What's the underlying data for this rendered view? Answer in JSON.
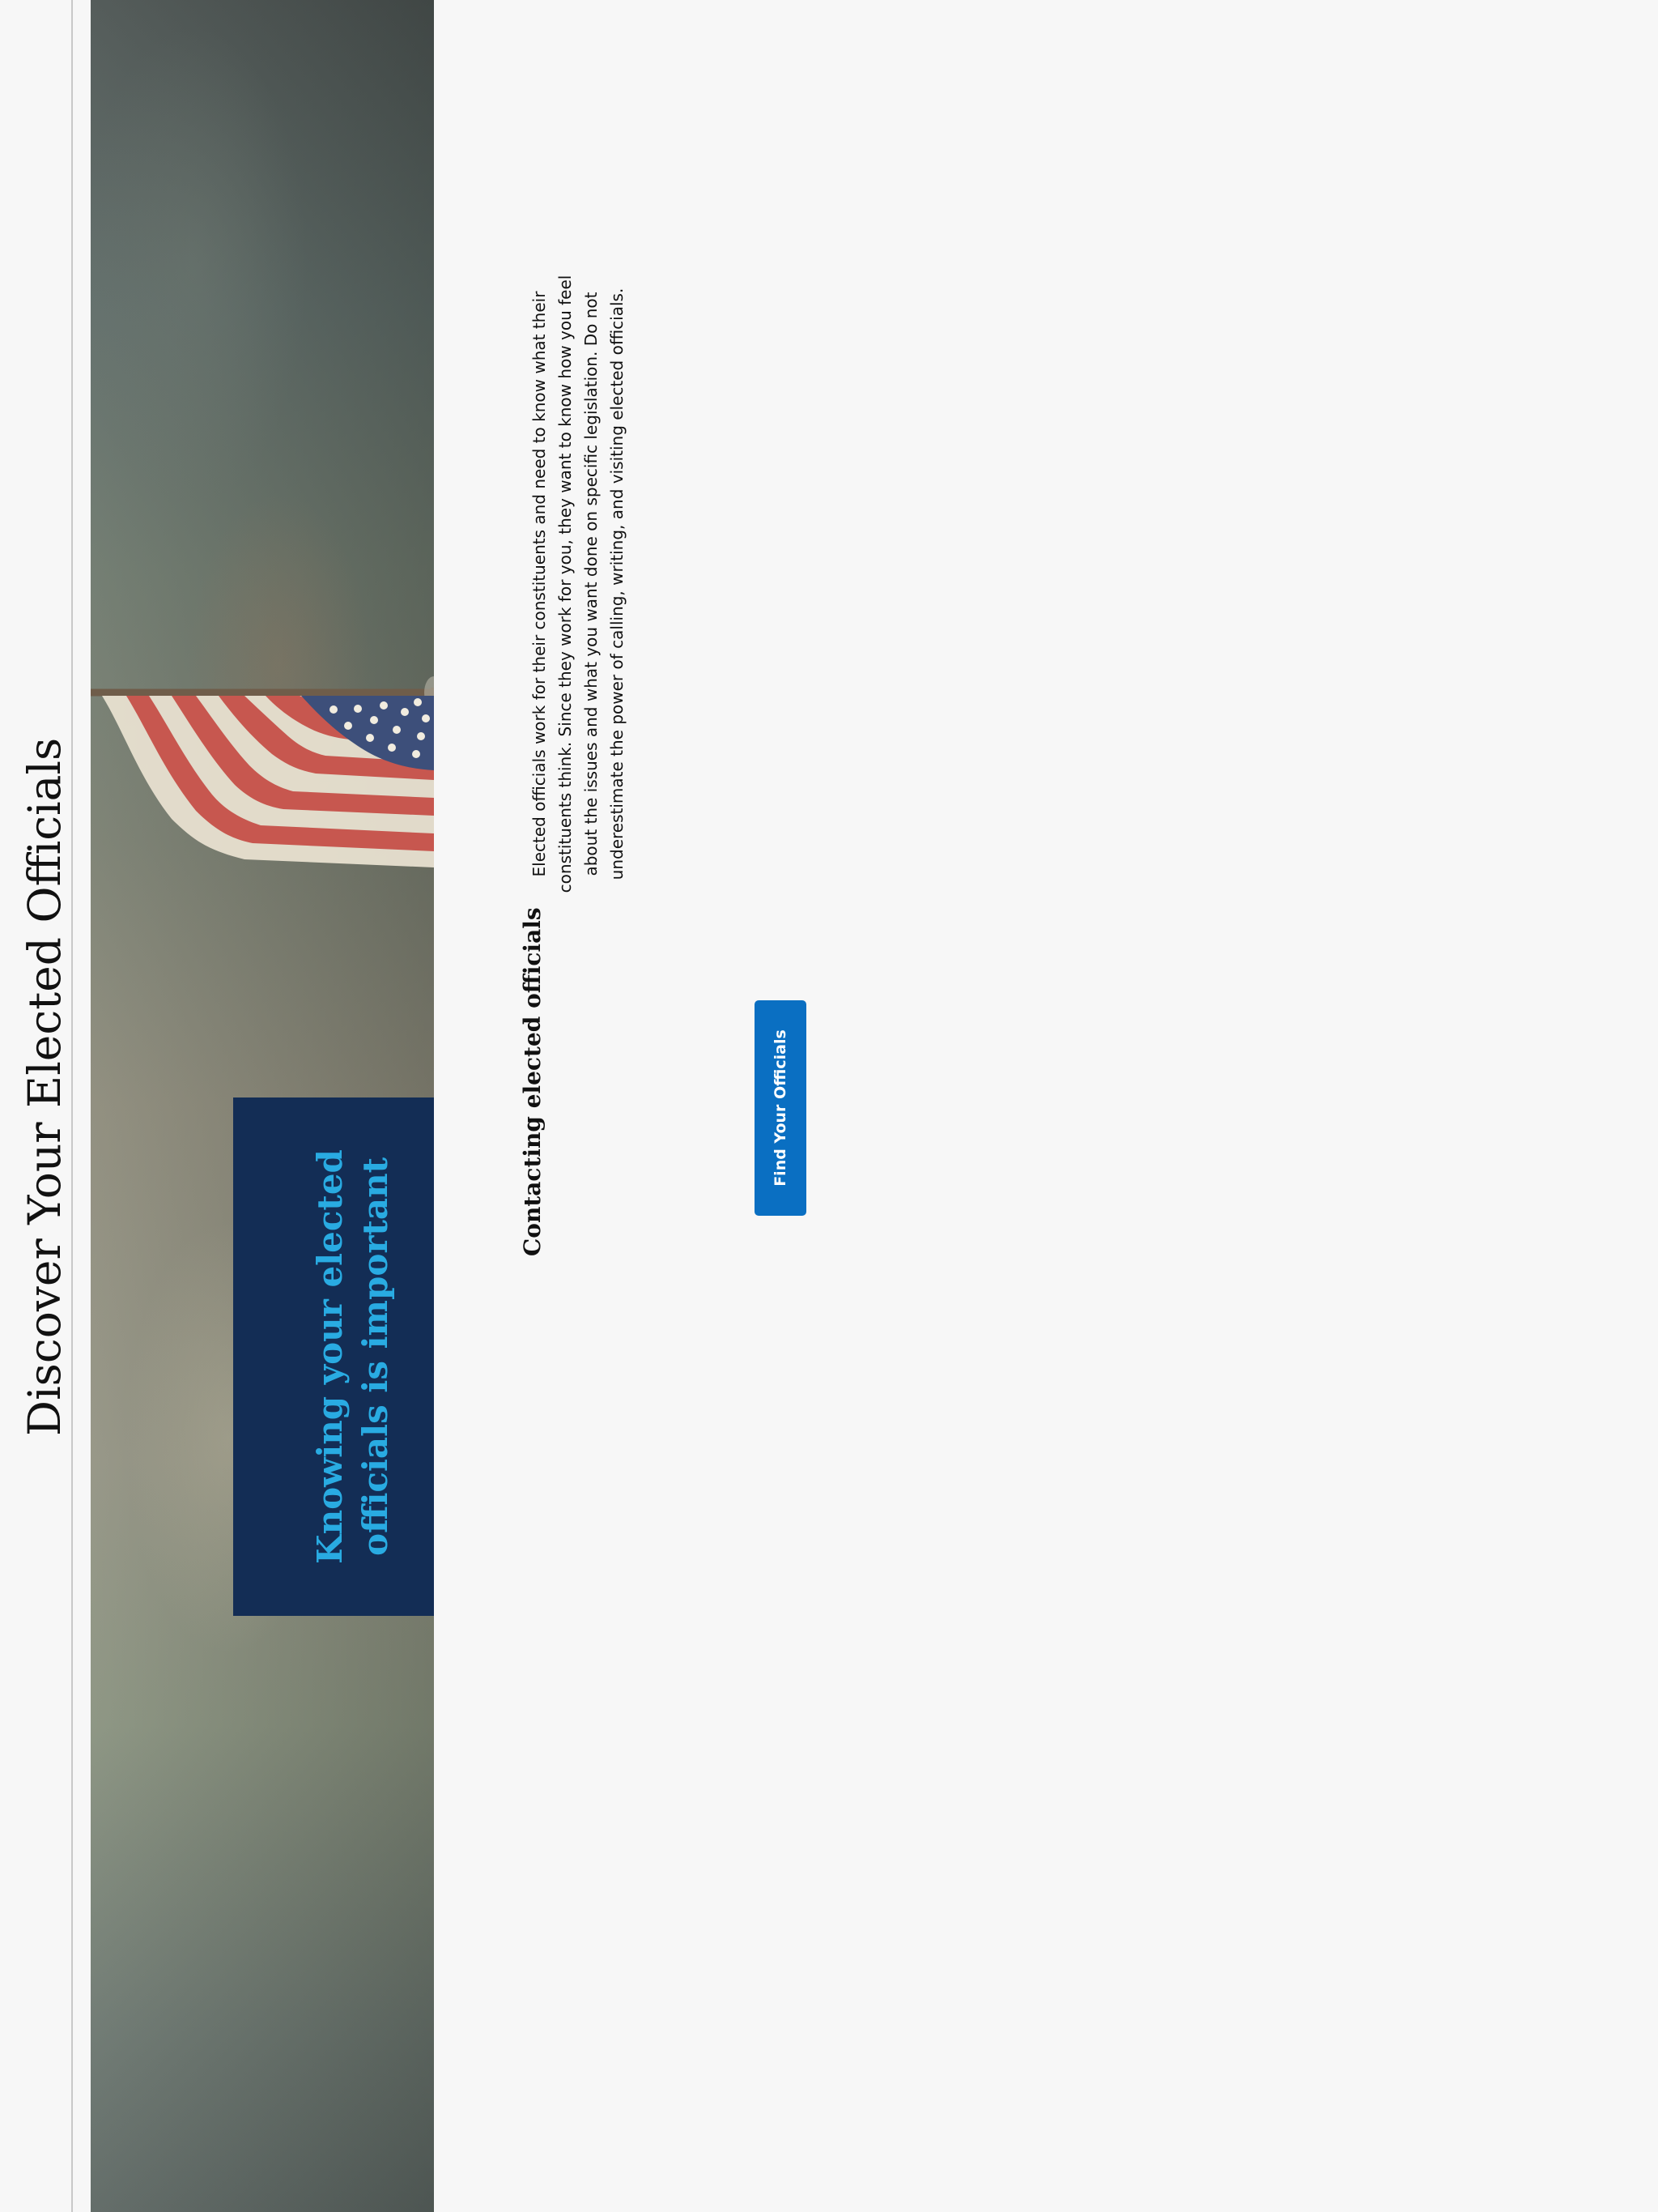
{
  "page": {
    "title": "Discover Your Elected Officials"
  },
  "hero": {
    "callout_heading": "Knowing your elected officials is important"
  },
  "contact_section": {
    "heading": "Contacting elected officials",
    "body": "Elected officials work for their constituents and need to know what their constituents think. Since they work for you, they want to know how you feel about the issues and what you want done on specific legislation. Do not underestimate the power of calling, writing, and visiting elected officials.",
    "cta_label": "Find Your Officials"
  },
  "colors": {
    "page_background": "#f7f7f7",
    "callout_background": "#132d55",
    "callout_text": "#29abe2",
    "button_background": "#0a6fc2",
    "button_text": "#ffffff"
  }
}
